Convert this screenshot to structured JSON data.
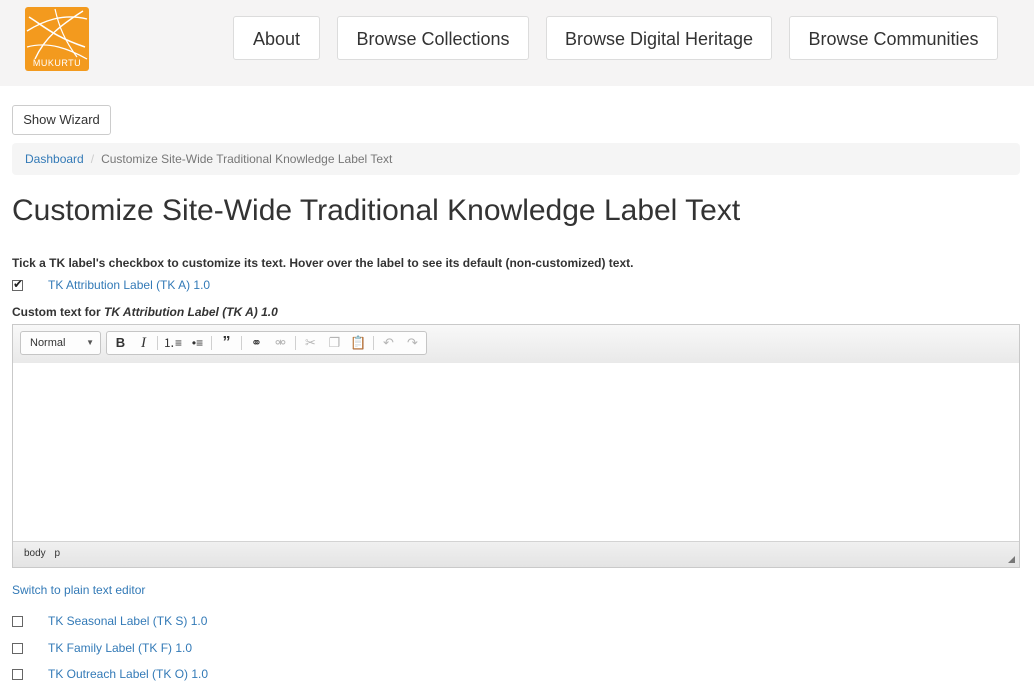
{
  "header": {
    "logo_text": "MUKURTU",
    "nav": [
      "About",
      "Browse Collections",
      "Browse Digital Heritage",
      "Browse Communities"
    ]
  },
  "wizard_button": "Show Wizard",
  "breadcrumb": {
    "link": "Dashboard",
    "separator": "/",
    "current": "Customize Site-Wide Traditional Knowledge Label Text"
  },
  "page_title": "Customize Site-Wide Traditional Knowledge Label Text",
  "instructions": "Tick a TK label's checkbox to customize its text. Hover over the label to see its default (non-customized) text.",
  "labels": [
    {
      "label": "TK Attribution Label (TK A) 1.0",
      "checked": true
    },
    {
      "label": "TK Seasonal Label (TK S) 1.0",
      "checked": false
    },
    {
      "label": "TK Family Label (TK F) 1.0",
      "checked": false
    },
    {
      "label": "TK Outreach Label (TK O) 1.0",
      "checked": false
    }
  ],
  "custom_text": {
    "prefix": "Custom text for ",
    "label": "TK Attribution Label (TK A) 1.0"
  },
  "editor": {
    "format_value": "Normal",
    "toolbar_icons": [
      "bold-icon",
      "italic-icon",
      "numbered-list-icon",
      "bulleted-list-icon",
      "blockquote-icon",
      "link-icon",
      "unlink-icon",
      "cut-icon",
      "copy-icon",
      "paste-icon",
      "undo-icon",
      "redo-icon"
    ],
    "path": [
      "body",
      "p"
    ]
  },
  "switch_link": "Switch to plain text editor"
}
